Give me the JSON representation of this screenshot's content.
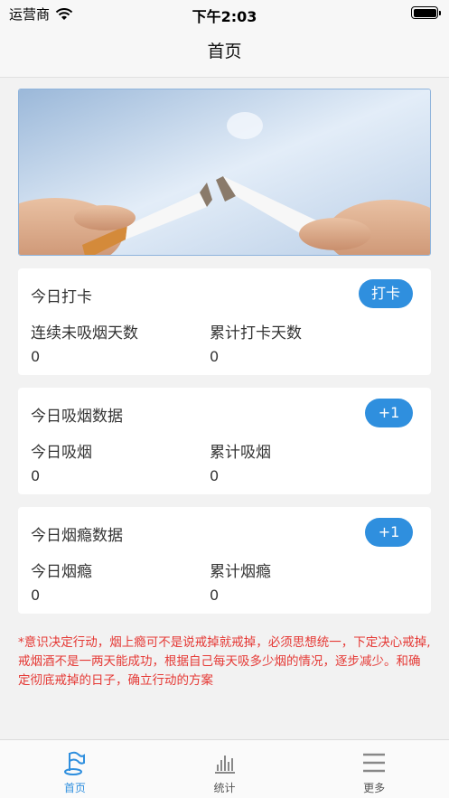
{
  "status_bar": {
    "carrier": "运营商",
    "time": "下午2:03"
  },
  "nav": {
    "title": "首页"
  },
  "banner": {
    "icon": "broken-cigarette-image"
  },
  "cards": [
    {
      "title": "今日打卡",
      "button": "打卡",
      "stat1_label": "连续未吸烟天数",
      "stat1_value": "0",
      "stat2_label": "累计打卡天数",
      "stat2_value": "0"
    },
    {
      "title": "今日吸烟数据",
      "button": "+1",
      "stat1_label": "今日吸烟",
      "stat1_value": "0",
      "stat2_label": "累计吸烟",
      "stat2_value": "0"
    },
    {
      "title": "今日烟瘾数据",
      "button": "+1",
      "stat1_label": "今日烟瘾",
      "stat1_value": "0",
      "stat2_label": "累计烟瘾",
      "stat2_value": "0"
    }
  ],
  "notice": "*意识决定行动，烟上瘾可不是说戒掉就戒掉，必须思想统一，下定决心戒掉,戒烟酒不是一两天能成功，根据自己每天吸多少烟的情况，逐步减少。和确定彻底戒掉的日子，确立行动的方案",
  "tabs": [
    {
      "label": "首页",
      "icon": "flag-icon",
      "active": true
    },
    {
      "label": "统计",
      "icon": "bar-chart-icon",
      "active": false
    },
    {
      "label": "更多",
      "icon": "menu-icon",
      "active": false
    }
  ],
  "colors": {
    "accent": "#2f8fde",
    "notice": "#e53935",
    "background": "#f2f2f2"
  }
}
